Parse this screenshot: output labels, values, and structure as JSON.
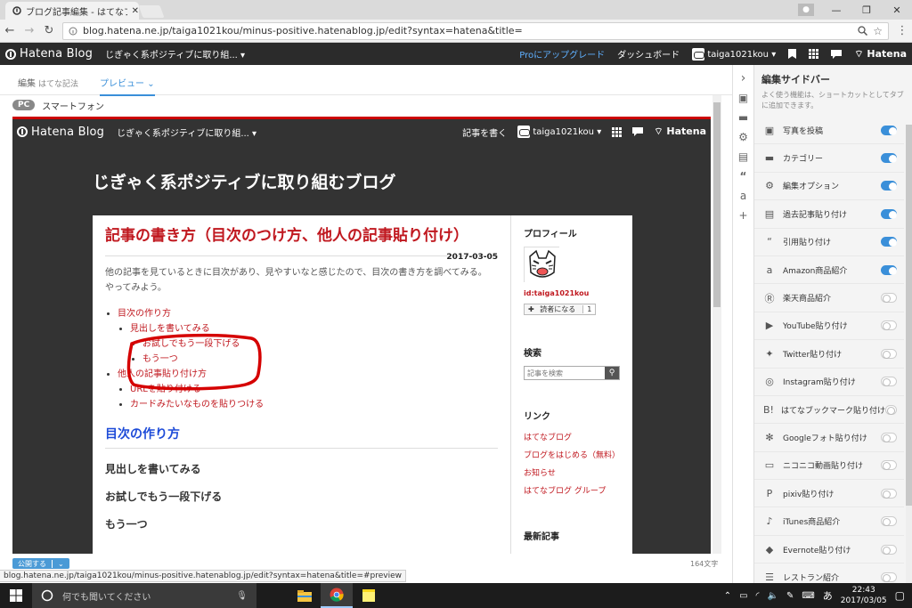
{
  "browser": {
    "tab_title": "ブログ記事編集 - はてなブロ",
    "url": "blog.hatena.ne.jp/taiga1021kou/minus-positive.hatenablog.jp/edit?syntax=hatena&title=",
    "status_url": "blog.hatena.ne.jp/taiga1021kou/minus-positive.hatenablog.jp/edit?syntax=hatena&title=#preview"
  },
  "topbar": {
    "logo": "Hatena Blog",
    "blog_select": "じぎゃく系ポジティブに取り組...",
    "upgrade": "Proにアップグレード",
    "dashboard": "ダッシュボード",
    "user": "taiga1021kou",
    "hatena": "Hatena"
  },
  "editor": {
    "tab_edit": "編集",
    "tab_edit_mode": "はてな記法",
    "tab_preview": "プレビュー",
    "device_pc": "PC",
    "device_phone": "スマートフォン",
    "publish": "公開する",
    "char_count": "164文字"
  },
  "preview": {
    "logo": "Hatena Blog",
    "blog_select": "じぎゃく系ポジティブに取り組...",
    "write": "記事を書く",
    "user": "taiga1021kou",
    "hatena": "Hatena",
    "blog_title": "じぎゃく系ポジティブに取り組むブログ",
    "entry_title": "記事の書き方（目次のつけ方、他人の記事貼り付け）",
    "entry_date": "2017-03-05",
    "body_line1": "他の記事を見ているときに目次があり、見やすいなと感じたので、目次の書き方を調べてみる。",
    "body_line2": "やってみよう。",
    "toc": {
      "item1": "目次の作り方",
      "item1_1": "見出しを書いてみる",
      "item1_1_1": "お試しでもう一段下げる",
      "item1_1_2": "もう一つ",
      "item2": "他人の記事貼り付け方",
      "item2_1": "URLを貼り付ける",
      "item2_2": "カードみたいなものを貼りつける"
    },
    "h3": "目次の作り方",
    "h4_1": "見出しを書いてみる",
    "h4_2": "お試しでもう一段下げる",
    "h4_3": "もう一つ",
    "side": {
      "profile_heading": "プロフィール",
      "profile_id": "id:taiga1021kou",
      "reader_btn": "読者になる",
      "reader_count": "1",
      "search_heading": "検索",
      "search_placeholder": "記事を検索",
      "links_heading": "リンク",
      "links": [
        "はてなブログ",
        "ブログをはじめる（無料）",
        "お知らせ",
        "はてなブログ グループ"
      ],
      "recent_heading": "最新記事"
    }
  },
  "edit_sidebar": {
    "title": "編集サイドバー",
    "description": "よく使う機能は、ショートカットとしてタブに追加できます。",
    "items": [
      {
        "label": "写真を投稿",
        "icon": "photo-icon",
        "on": true
      },
      {
        "label": "カテゴリー",
        "icon": "folder-icon",
        "on": true
      },
      {
        "label": "編集オプション",
        "icon": "gear-icon",
        "on": true
      },
      {
        "label": "過去記事貼り付け",
        "icon": "document-icon",
        "on": true
      },
      {
        "label": "引用貼り付け",
        "icon": "quote-icon",
        "on": true
      },
      {
        "label": "Amazon商品紹介",
        "icon": "amazon-icon",
        "on": true
      },
      {
        "label": "楽天商品紹介",
        "icon": "rakuten-icon",
        "on": false
      },
      {
        "label": "YouTube貼り付け",
        "icon": "youtube-icon",
        "on": false
      },
      {
        "label": "Twitter貼り付け",
        "icon": "twitter-icon",
        "on": false
      },
      {
        "label": "Instagram貼り付け",
        "icon": "instagram-icon",
        "on": false
      },
      {
        "label": "はてなブックマーク貼り付け",
        "icon": "hatena-bookmark-icon",
        "on": false
      },
      {
        "label": "Googleフォト貼り付け",
        "icon": "google-photos-icon",
        "on": false
      },
      {
        "label": "ニコニコ動画貼り付け",
        "icon": "niconico-icon",
        "on": false
      },
      {
        "label": "pixiv貼り付け",
        "icon": "pixiv-icon",
        "on": false
      },
      {
        "label": "iTunes商品紹介",
        "icon": "music-icon",
        "on": false
      },
      {
        "label": "Evernote貼り付け",
        "icon": "evernote-icon",
        "on": false
      },
      {
        "label": "レストラン紹介",
        "icon": "restaurant-icon",
        "on": false
      }
    ]
  },
  "taskbar": {
    "search_placeholder": "何でも聞いてください",
    "time": "22:43",
    "date": "2017/03/05"
  },
  "colors": {
    "accent": "#3a8fd9",
    "entry_title": "#c0181f",
    "heading_blue": "#1d4bd8",
    "topbar": "#2b2b2b"
  }
}
